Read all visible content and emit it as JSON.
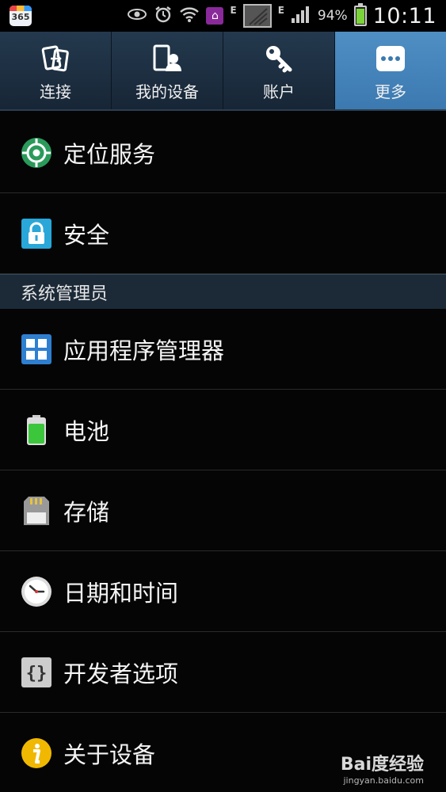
{
  "status_bar": {
    "calendar_number": "365",
    "network_type": "E",
    "network_type_2": "E",
    "battery_percent": "94%",
    "battery_level": 0.94,
    "time": "10:11"
  },
  "tabs": [
    {
      "label": "连接",
      "icon": "connect-icon"
    },
    {
      "label": "我的设备",
      "icon": "device-icon"
    },
    {
      "label": "账户",
      "icon": "key-icon"
    },
    {
      "label": "更多",
      "icon": "more-icon",
      "active": true
    }
  ],
  "items": {
    "location": "定位服务",
    "security": "安全",
    "section_admin": "系统管理员",
    "app_manager": "应用程序管理器",
    "battery": "电池",
    "storage": "存储",
    "datetime": "日期和时间",
    "developer": "开发者选项",
    "about": "关于设备"
  },
  "watermark": {
    "brand": "Bai度经验",
    "url": "jingyan.baidu.com"
  }
}
